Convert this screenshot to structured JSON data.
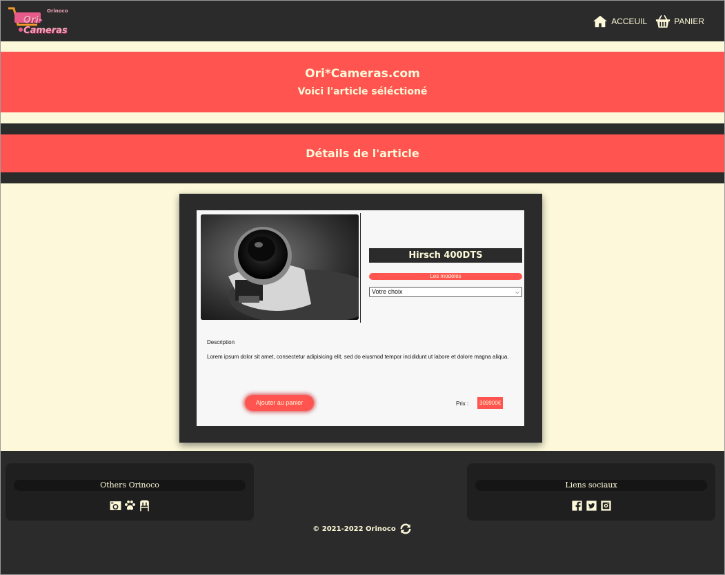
{
  "header": {
    "logo_text": "Ori-Cameras",
    "logo_sub": "Orinoco",
    "nav": [
      {
        "label": "ACCEUIL",
        "icon": "home-icon"
      },
      {
        "label": "PANIER",
        "icon": "basket-icon"
      }
    ]
  },
  "hero": {
    "site_name": "Ori*Cameras.com",
    "subtitle": "Voici l'article séléctioné"
  },
  "section_title": "Détails de l'article",
  "product": {
    "name": "Hirsch 400DTS",
    "models_label": "Les modèles",
    "select_value": "Votre choix",
    "description_title": "Description",
    "description": "Lorem ipsum dolor sit amet, consectetur adipisicing elit, sed do eiusmod tempor incididunt ut labore et dolore magna aliqua.",
    "add_to_cart": "Ajouter au panier",
    "price_label": "Prix :",
    "price": "309900€"
  },
  "footer": {
    "left_title": "Others Orinoco",
    "left_icons": [
      "camera-icon",
      "paw-icon",
      "chair-icon"
    ],
    "right_title": "Liens sociaux",
    "right_icons": [
      "facebook-icon",
      "twitter-icon",
      "instagram-icon"
    ],
    "copyright": "© 2021-2022 Orinoco"
  },
  "colors": {
    "dark": "#2b2b2b",
    "red": "#ff5450",
    "cream": "#fcf8d9"
  }
}
